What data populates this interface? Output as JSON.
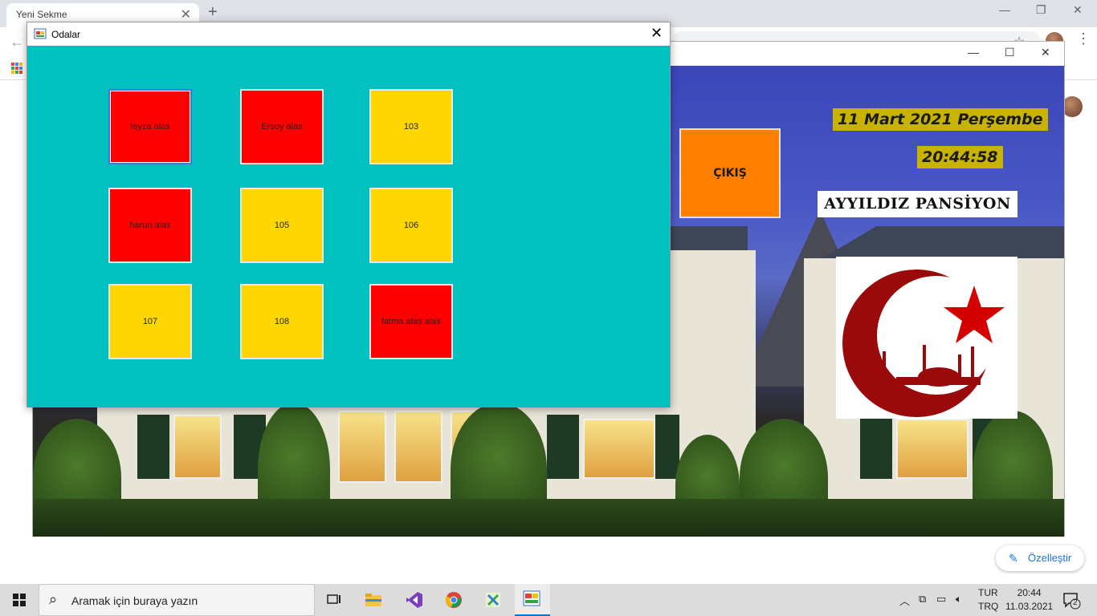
{
  "browser": {
    "tab_title": "Yeni Sekme",
    "tab_close": "✕",
    "new_tab": "+",
    "minimize": "—",
    "restore": "❐",
    "close": "✕",
    "back": "←",
    "star": "☆",
    "customize_label": "Özelleştir",
    "customize_icon": "✎"
  },
  "app_window": {
    "minimize": "—",
    "maximize": "☐",
    "close": "✕",
    "exit_label": "ÇIKIŞ",
    "date": "11 Mart 2021 Perşembe",
    "time": "20:44:58",
    "brand": "AYYILDIZ PANSİYON"
  },
  "dialog": {
    "title": "Odalar",
    "close": "✕",
    "rooms": [
      {
        "label": "feyza  alas",
        "status": "occupied",
        "color": "#ff0000"
      },
      {
        "label": "Ersoy alas",
        "status": "occupied",
        "color": "#ff0000"
      },
      {
        "label": "103",
        "status": "empty",
        "color": "#ffd700"
      },
      {
        "label": "harun alas",
        "status": "occupied",
        "color": "#ff0000"
      },
      {
        "label": "105",
        "status": "empty",
        "color": "#ffd700"
      },
      {
        "label": "106",
        "status": "empty",
        "color": "#ffd700"
      },
      {
        "label": "107",
        "status": "empty",
        "color": "#ffd700"
      },
      {
        "label": "108",
        "status": "empty",
        "color": "#ffd700"
      },
      {
        "label": "fatma alas alas",
        "status": "occupied",
        "color": "#ff0000"
      }
    ]
  },
  "taskbar": {
    "search_placeholder": "Aramak için buraya yazın",
    "search_icon": "⌕",
    "lang_top": "TUR",
    "lang_bottom": "TRQ",
    "clock_time": "20:44",
    "clock_date": "11.03.2021",
    "notification_count": "2",
    "tray_icons": [
      "chevron-up-icon",
      "network-icon",
      "battery-icon",
      "volume-icon"
    ]
  },
  "colors": {
    "dialog_bg": "#00c0c0",
    "occupied": "#ff0000",
    "empty": "#ffd700",
    "exit": "#ff7f00",
    "label_bg": "#c8b400"
  }
}
